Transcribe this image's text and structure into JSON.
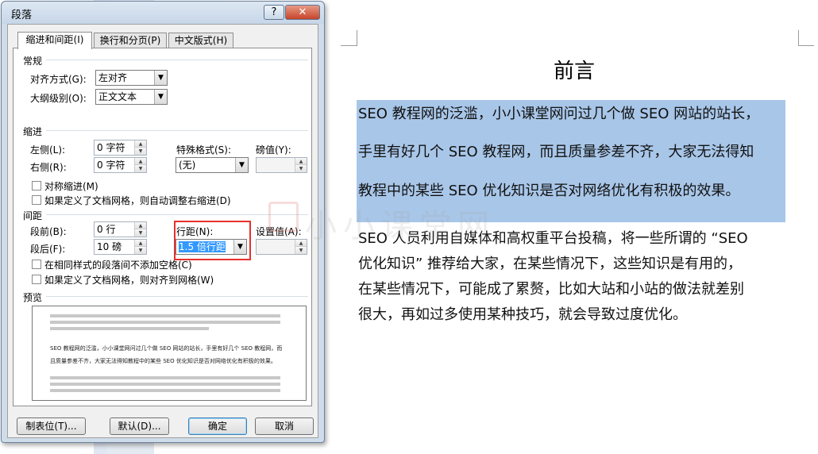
{
  "dialog": {
    "title": "段落",
    "help_label": "?",
    "close_label": "✕",
    "tabs": [
      "缩进和间距(I)",
      "换行和分页(P)",
      "中文版式(H)"
    ],
    "general": {
      "section": "常规",
      "alignment_label": "对齐方式(G):",
      "alignment_value": "左对齐",
      "outline_label": "大纲级别(O):",
      "outline_value": "正文文本"
    },
    "indent": {
      "section": "缩进",
      "left_label": "左侧(L):",
      "left_value": "0 字符",
      "right_label": "右侧(R):",
      "right_value": "0 字符",
      "special_label": "特殊格式(S):",
      "special_value": "(无)",
      "by_label": "磅值(Y):",
      "by_value": "",
      "mirror_label": "对称缩进(M)",
      "auto_adjust_label": "如果定义了文档网格，则自动调整右缩进(D)"
    },
    "spacing": {
      "section": "间距",
      "before_label": "段前(B):",
      "before_value": "0 行",
      "after_label": "段后(F):",
      "after_value": "10 磅",
      "line_label": "行距(N):",
      "line_value": "1.5 倍行距",
      "at_label": "设置值(A):",
      "at_value": "",
      "no_space_label": "在相同样式的段落间不添加空格(C)",
      "snap_grid_label": "如果定义了文档网格，则对齐到网格(W)"
    },
    "preview": {
      "section": "预览",
      "sample_line1": "SEO 教程网的泛滥，小小课堂网问过几个做 SEO 网站的站长，手里有好几个 SEO 教程网，而",
      "sample_line2": "且质量参差不齐，大家无法得知教程中的某些 SEO 优化知识是否对网络优化有积极的效果。"
    },
    "buttons": {
      "tabs": "制表位(T)...",
      "default": "默认(D)...",
      "ok": "确定",
      "cancel": "取消"
    }
  },
  "document": {
    "title": "前言",
    "para1_lines": [
      "SEO 教程网的泛滥，小小课堂网问过几个做 SEO 网站的站长，",
      "手里有好几个 SEO 教程网，而且质量参差不齐，大家无法得知",
      "教程中的某些 SEO 优化知识是否对网络优化有积极的效果。"
    ],
    "para2_lines": [
      "SEO 人员利用自媒体和高权重平台投稿，将一些所谓的 “SEO",
      "优化知识” 推荐给大家，在某些情况下，这些知识是有用的，",
      "在某些情况下，可能成了累赘，比如大站和小站的做法就差别",
      "很大，再如过多使用某种技巧，就会导致过度优化。"
    ],
    "watermark": "小小课堂网"
  },
  "colors": {
    "selection": "#a8c6e8",
    "highlight_box": "#e8302d",
    "dialog_frame": "#cfdcea"
  }
}
